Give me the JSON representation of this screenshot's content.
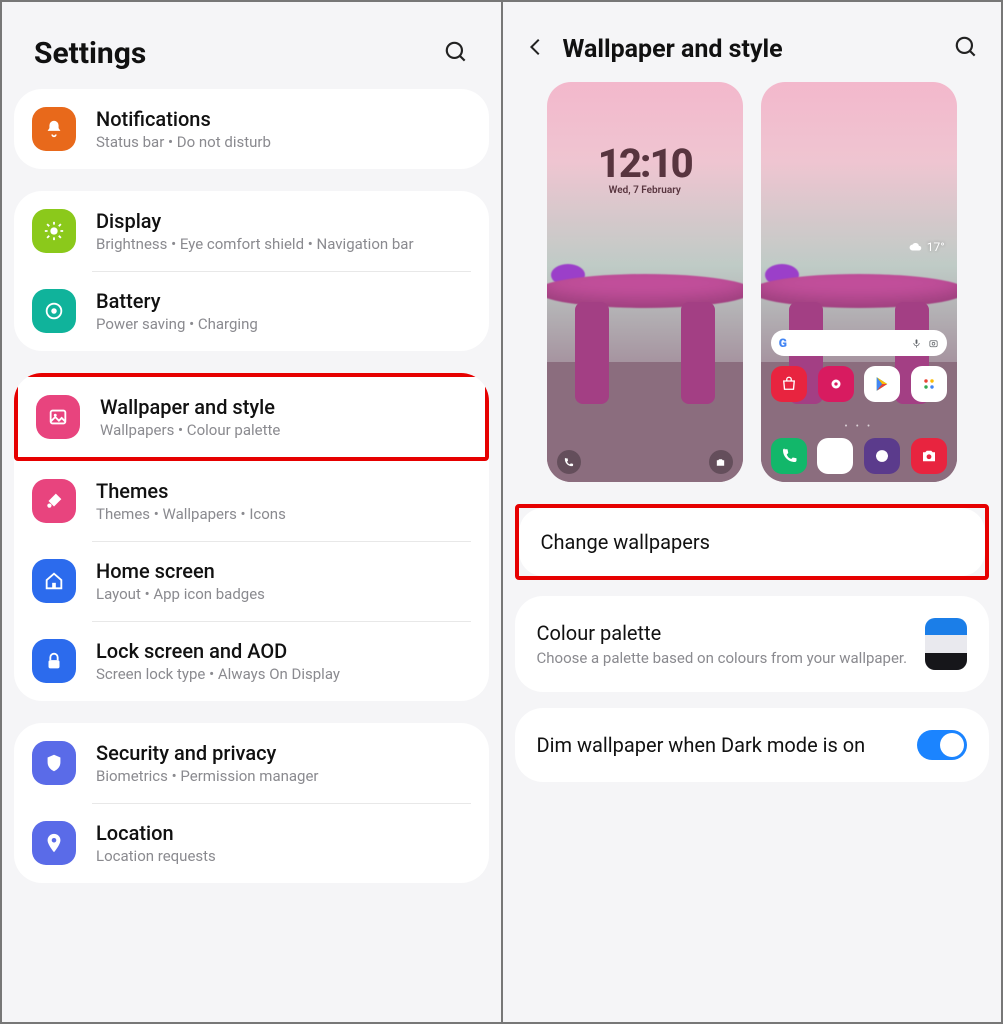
{
  "left": {
    "title": "Settings",
    "groups": [
      {
        "items": [
          {
            "key": "notifications",
            "title": "Notifications",
            "sub": "Status bar  •  Do not disturb",
            "color": "#e8691b",
            "icon": "bell"
          }
        ]
      },
      {
        "items": [
          {
            "key": "display",
            "title": "Display",
            "sub": "Brightness  •  Eye comfort shield  •  Navigation bar",
            "color": "#8bc91b",
            "icon": "sun"
          },
          {
            "key": "battery",
            "title": "Battery",
            "sub": "Power saving  •  Charging",
            "color": "#10b39b",
            "icon": "battery"
          }
        ]
      },
      {
        "items": [
          {
            "key": "wallpaper",
            "title": "Wallpaper and style",
            "sub": "Wallpapers  •  Colour palette",
            "color": "#e8447e",
            "icon": "image",
            "highlight": true
          },
          {
            "key": "themes",
            "title": "Themes",
            "sub": "Themes  •  Wallpapers  •  Icons",
            "color": "#e8447e",
            "icon": "brush"
          },
          {
            "key": "home",
            "title": "Home screen",
            "sub": "Layout  •  App icon badges",
            "color": "#2c6bed",
            "icon": "home"
          },
          {
            "key": "lock",
            "title": "Lock screen and AOD",
            "sub": "Screen lock type  •  Always On Display",
            "color": "#2c6bed",
            "icon": "lock"
          }
        ]
      },
      {
        "items": [
          {
            "key": "security",
            "title": "Security and privacy",
            "sub": "Biometrics  •  Permission manager",
            "color": "#5a6be8",
            "icon": "shield"
          },
          {
            "key": "location",
            "title": "Location",
            "sub": "Location requests",
            "color": "#5a6be8",
            "icon": "pin"
          }
        ]
      }
    ]
  },
  "right": {
    "title": "Wallpaper and style",
    "lock_preview": {
      "time": "12:10",
      "date": "Wed, 7 February"
    },
    "home_preview": {
      "temp": "17°"
    },
    "change_wallpapers": "Change wallpapers",
    "colour_palette": {
      "title": "Colour palette",
      "sub": "Choose a palette based on colours from your wallpaper.",
      "colors": [
        "#1b7ee8",
        "#e9e9ee",
        "#16161a"
      ]
    },
    "dim": {
      "title": "Dim wallpaper when Dark mode is on",
      "on": true
    }
  }
}
